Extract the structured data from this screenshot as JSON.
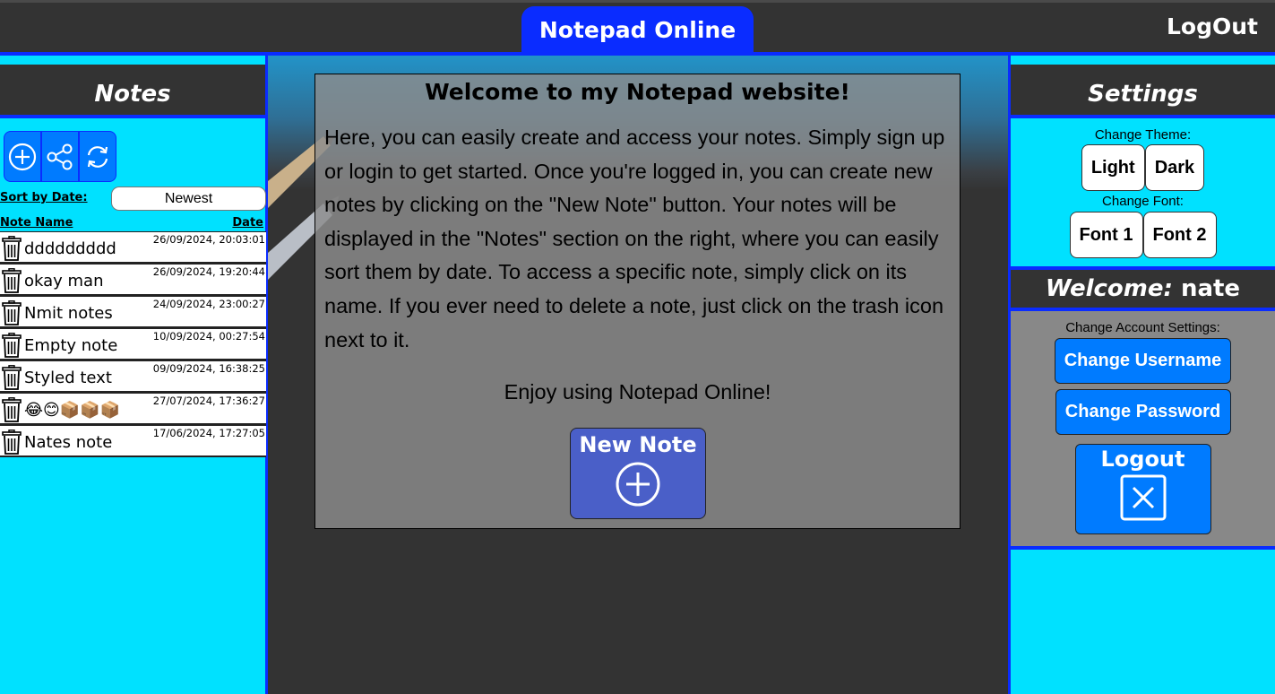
{
  "header": {
    "title": "Notepad Online",
    "logout_label": "LogOut"
  },
  "notes_panel": {
    "title": "Notes",
    "sort_label": "Sort by Date:",
    "sort_value": "Newest",
    "col_name": "Note Name",
    "col_date": "Date",
    "notes": [
      {
        "name": "ddddddddd",
        "date": "26/09/2024, 20:03:01"
      },
      {
        "name": "okay man",
        "date": "26/09/2024, 19:20:44"
      },
      {
        "name": "Nmit notes",
        "date": "24/09/2024, 23:00:27"
      },
      {
        "name": "Empty note",
        "date": "10/09/2024, 00:27:54"
      },
      {
        "name": "Styled text",
        "date": "09/09/2024, 16:38:25"
      },
      {
        "name": "😂😊📦📦📦",
        "date": "27/07/2024, 17:36:27"
      },
      {
        "name": "Nates note",
        "date": "17/06/2024, 17:27:05"
      }
    ]
  },
  "main": {
    "title": "Welcome to my Notepad website!",
    "body": "Here, you can easily create and access your notes. Simply sign up or login to get started. Once you're logged in, you can create new notes by clicking on the \"New Note\" button. Your notes will be displayed in the \"Notes\" section on the right, where you can easily sort them by date. To access a specific note, simply click on its name. If you ever need to delete a note, just click on the trash icon next to it.",
    "enjoy": "Enjoy using Notepad Online!",
    "new_note_label": "New Note"
  },
  "settings": {
    "title": "Settings",
    "theme_label": "Change Theme:",
    "theme_light": "Light",
    "theme_dark": "Dark",
    "font_label": "Change Font:",
    "font_1": "Font 1",
    "font_2": "Font 2",
    "welcome_label": "Welcome:",
    "username": "nate",
    "account_label": "Change Account Settings:",
    "change_username": "Change Username",
    "change_password": "Change Password",
    "logout_label": "Logout"
  },
  "colors": {
    "accent_blue": "#0a2cff",
    "cyan": "#00e1ff",
    "button_blue": "#007bff",
    "dark": "#333333"
  }
}
